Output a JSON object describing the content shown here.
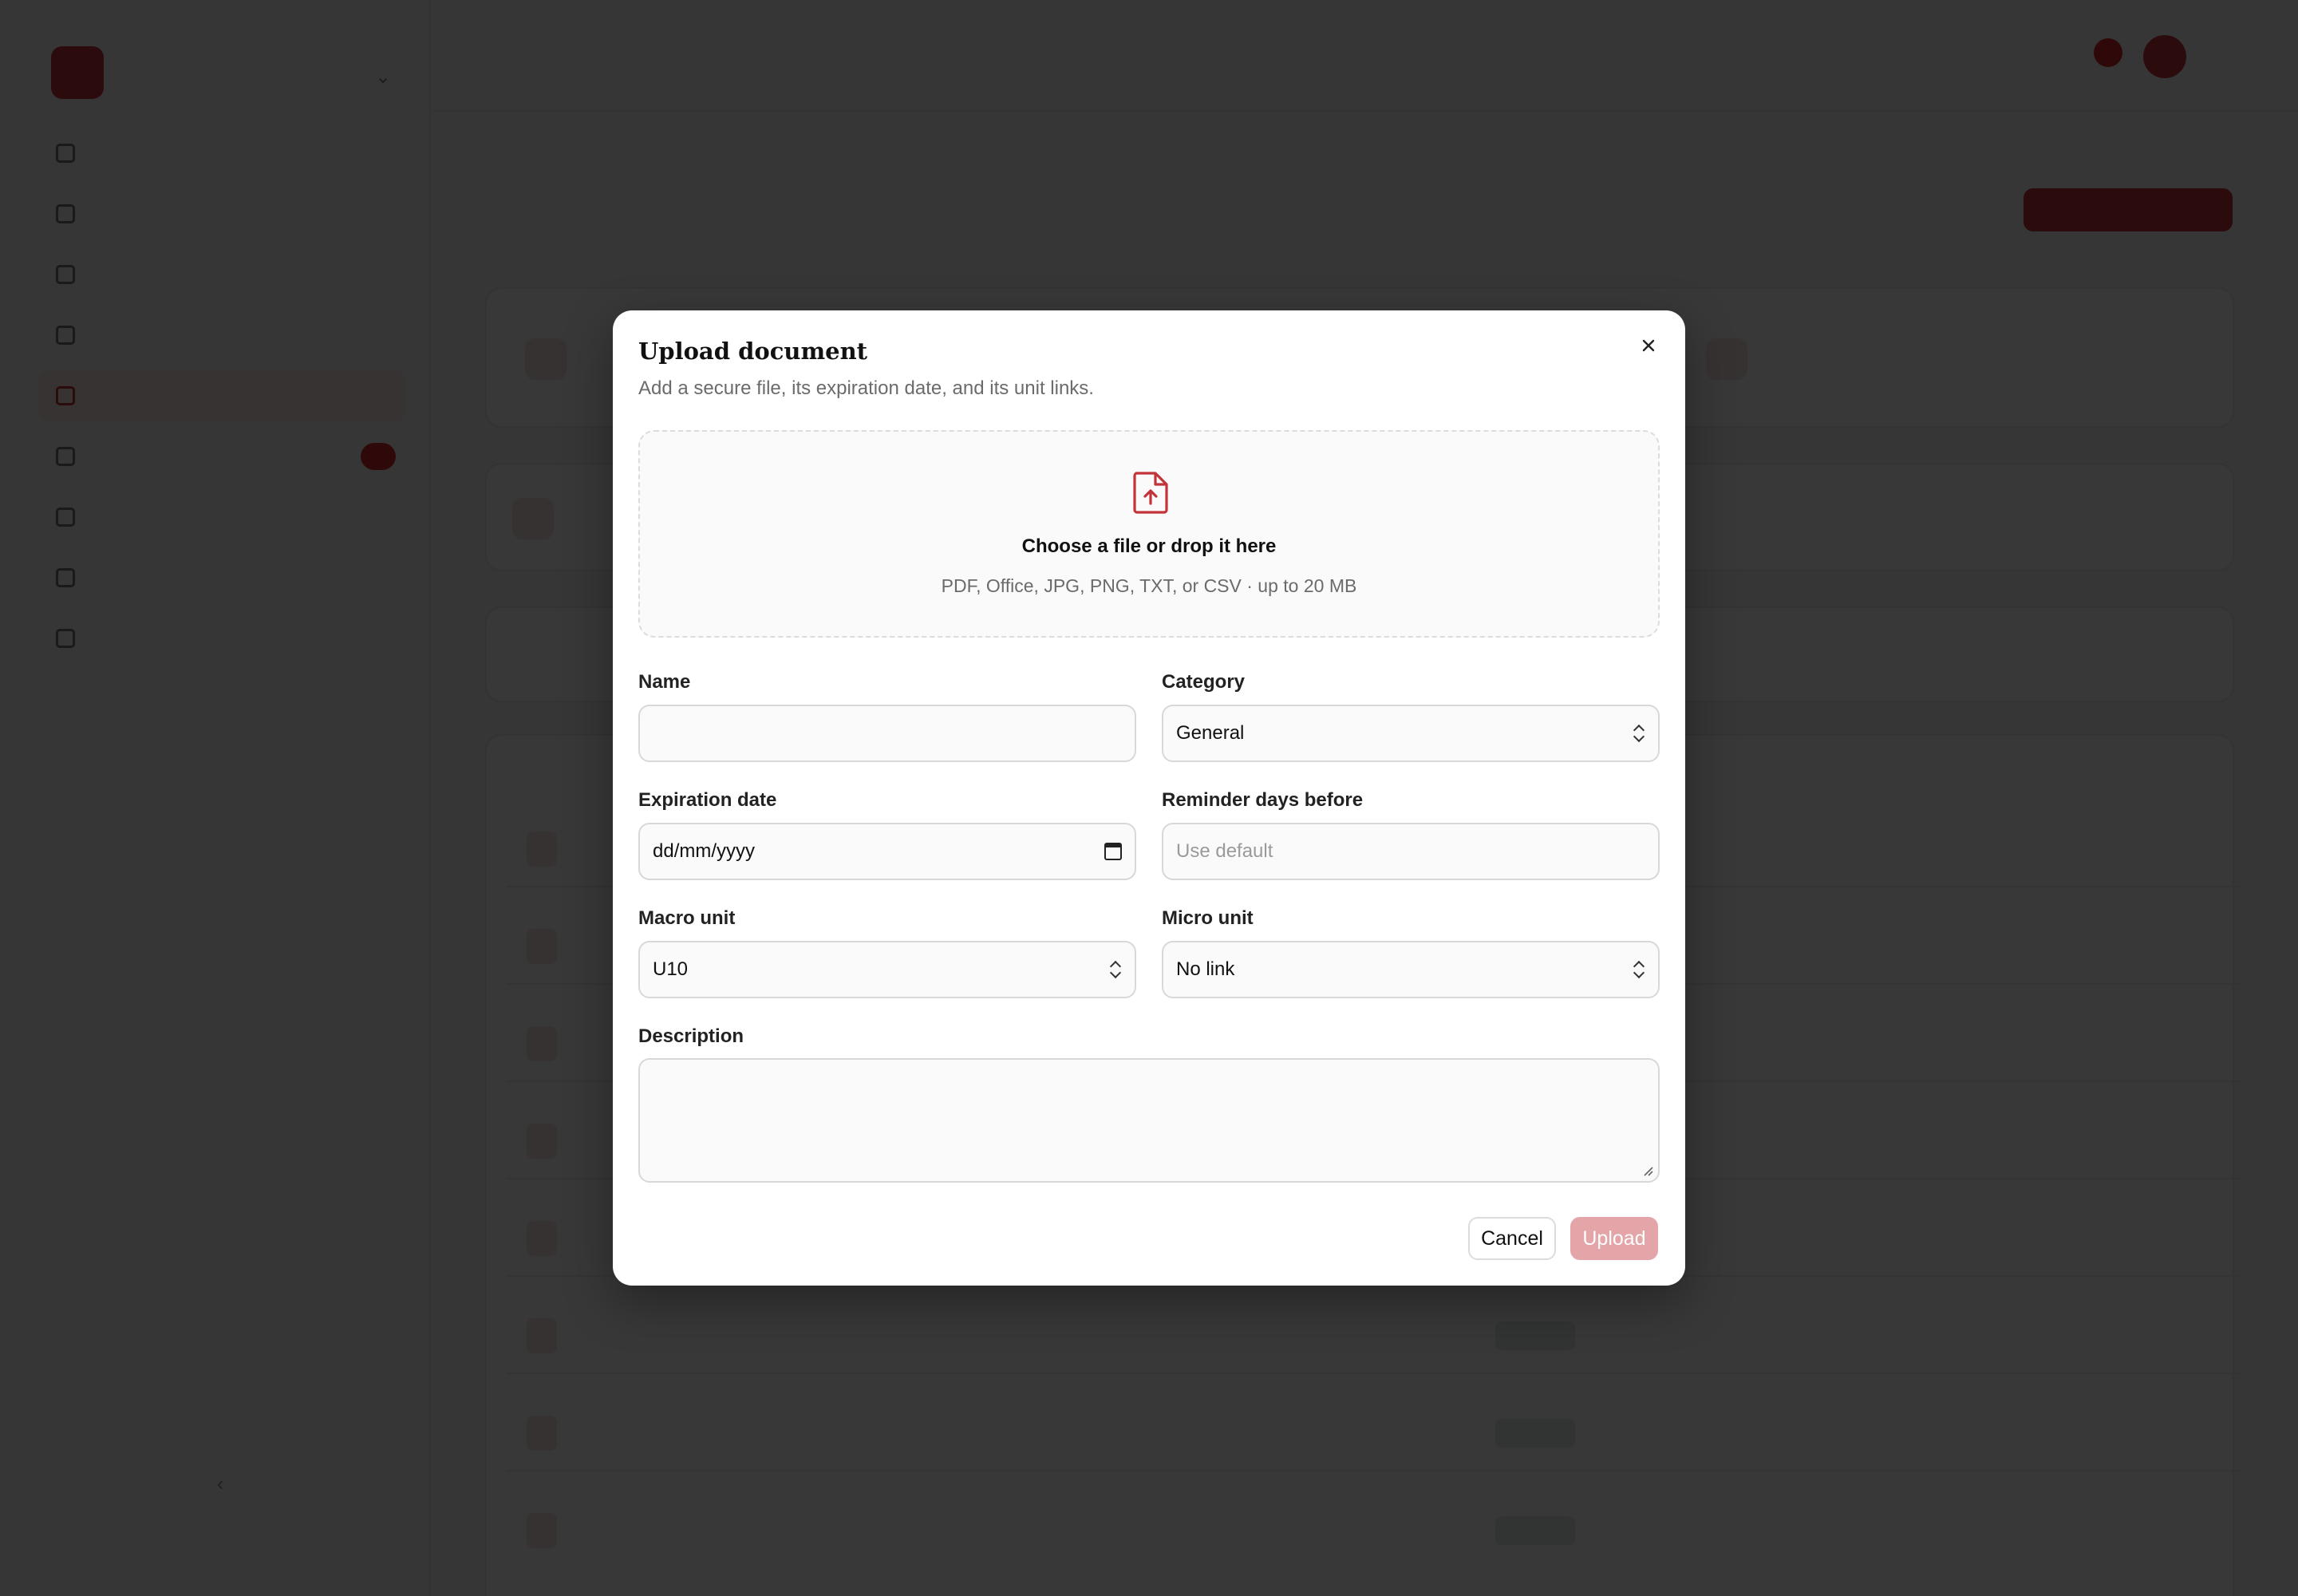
{
  "modal": {
    "title": "Upload document",
    "subtitle": "Add a secure file, its expiration date, and its unit links.",
    "dropzone": {
      "title": "Choose a file or drop it here",
      "hint": "PDF, Office, JPG, PNG, TXT, or CSV · up to 20 MB",
      "icon": "file-upload-icon"
    },
    "fields": {
      "name": {
        "label": "Name",
        "value": ""
      },
      "category": {
        "label": "Category",
        "value": "General"
      },
      "expiration": {
        "label": "Expiration date",
        "value": "dd/mm/yyyy"
      },
      "reminder": {
        "label": "Reminder days before",
        "placeholder": "Use default"
      },
      "macro_unit": {
        "label": "Macro unit",
        "value": "U10"
      },
      "micro_unit": {
        "label": "Micro unit",
        "value": "No link"
      },
      "description": {
        "label": "Description",
        "value": ""
      }
    },
    "buttons": {
      "cancel": "Cancel",
      "upload": "Upload"
    }
  },
  "colors": {
    "accent": "#c2333a",
    "upload_disabled": "#e4a5a8",
    "overlay": "rgba(0,0,0,0.78)"
  }
}
